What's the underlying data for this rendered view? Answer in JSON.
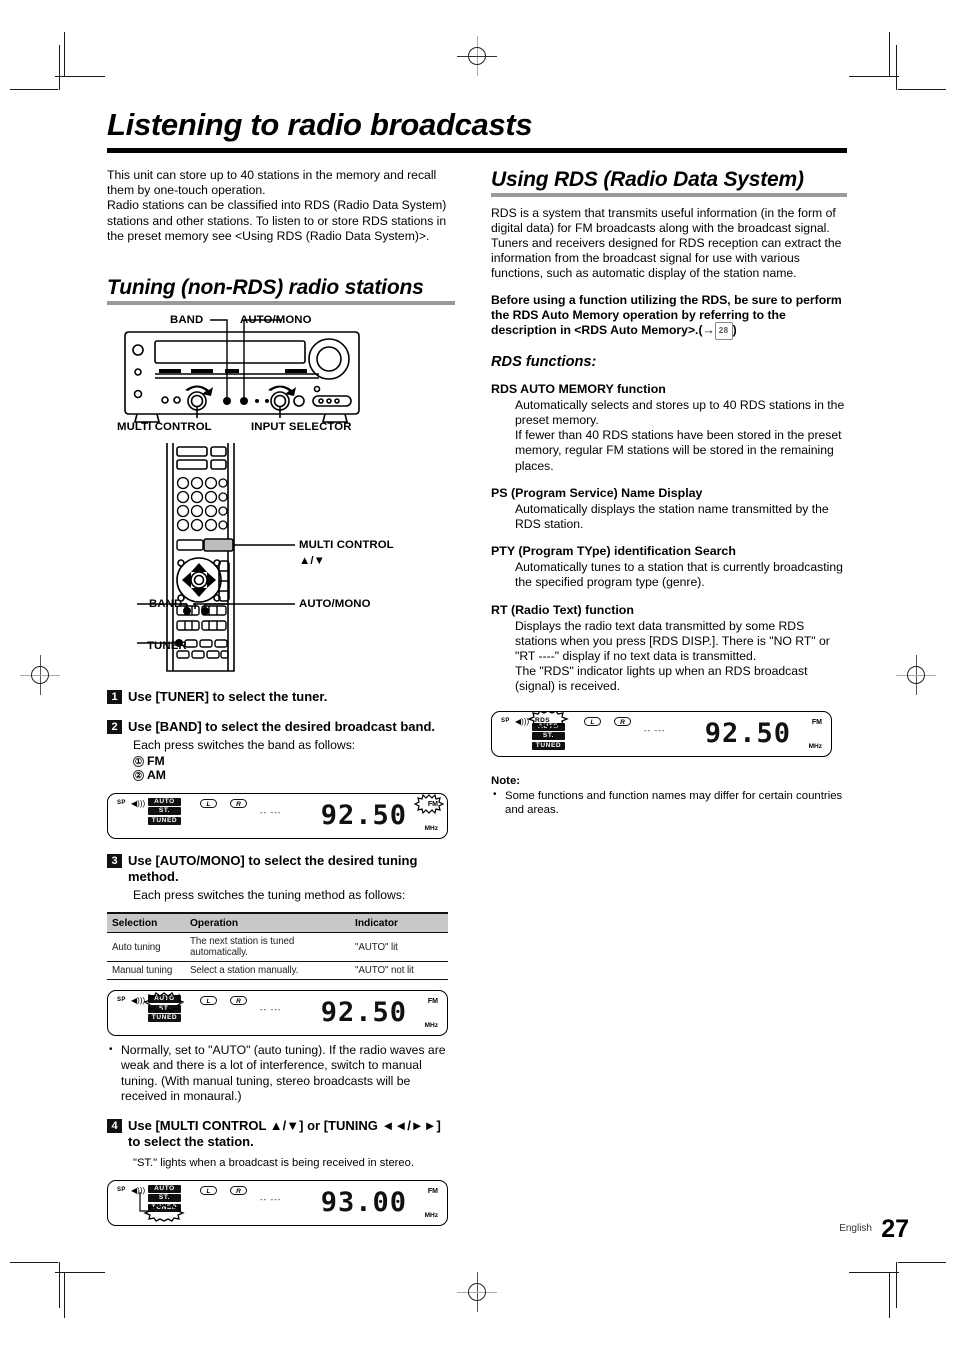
{
  "chapter": {
    "title": "Listening to radio broadcasts"
  },
  "left": {
    "intro": [
      "This unit can store up to 40 stations in the memory and recall them by one-touch operation.",
      "Radio stations can be classified into RDS (Radio Data System) stations and other stations. To listen to or store RDS stations in the preset memory see <Using RDS (Radio Data System)>."
    ],
    "section_title": "Tuning (non-RDS) radio stations",
    "unit_labels": {
      "band": "BAND",
      "auto_mono": "AUTO/MONO",
      "multi_control": "MULTI CONTROL",
      "input_selector": "INPUT SELECTOR"
    },
    "remote_labels": {
      "multi_control": "MULTI CONTROL",
      "multi_control_arrows": "▲/▼",
      "band": "BAND",
      "auto_mono": "AUTO/MONO",
      "tuner": "TUNER"
    },
    "steps": [
      {
        "num": "1",
        "title": "Use [TUNER] to select the tuner."
      },
      {
        "num": "2",
        "title": "Use [BAND] to select the desired broadcast band.",
        "sub": "Each press switches the band as follows:",
        "options": [
          {
            "marker": "①",
            "label": "FM"
          },
          {
            "marker": "②",
            "label": "AM"
          }
        ]
      },
      {
        "num": "3",
        "title": "Use [AUTO/MONO] to select the desired tuning method.",
        "sub": "Each press switches the tuning method as follows:"
      },
      {
        "num": "4",
        "title": "Use [MULTI CONTROL ▲/▼] or [TUNING ◄◄/►►] to select the station.",
        "caption": "\"ST.\" lights when a broadcast is being received in stereo."
      }
    ],
    "table": {
      "headers": [
        "Selection",
        "Operation",
        "Indicator"
      ],
      "rows": [
        [
          "Auto tuning",
          "The next station is tuned automatically.",
          "\"AUTO\" lit"
        ],
        [
          "Manual tuning",
          "Select a station manually.",
          "\"AUTO\" not lit"
        ]
      ]
    },
    "auto_note": "Normally, set to \"AUTO\" (auto tuning). If the radio waves are weak and there is a lot of interference, switch to manual tuning. (With manual tuning, stereo broadcasts will be received in monaural.)",
    "displays": [
      {
        "id": "display-band-fm",
        "sp": "SP",
        "speaker_icon": "speaker-icon",
        "indicators": [
          "AUTO",
          "ST.",
          "TUNED"
        ],
        "channels": [
          "L",
          "R"
        ],
        "dashes": "--  ---",
        "frequency": "92.50",
        "band": "FM",
        "unit": "MHz",
        "highlight": "FM"
      },
      {
        "id": "display-tuning-auto",
        "sp": "SP",
        "speaker_icon": "speaker-icon",
        "indicators": [
          "AUTO",
          "ST.",
          "TUNED"
        ],
        "channels": [
          "L",
          "R"
        ],
        "dashes": "--  ---",
        "frequency": "92.50",
        "band": "FM",
        "unit": "MHz",
        "highlight": "AUTO"
      },
      {
        "id": "display-station-tuned",
        "sp": "SP",
        "speaker_icon": "speaker-icon",
        "indicators": [
          "AUTO",
          "ST.",
          "TUNED"
        ],
        "channels": [
          "L",
          "R"
        ],
        "dashes": "--  ---",
        "frequency": "93.00",
        "band": "FM",
        "unit": "MHz",
        "highlight": "TUNED"
      }
    ]
  },
  "right": {
    "section_title": "Using RDS (Radio Data System)",
    "intro": "RDS is a system that transmits useful information (in the form of digital data) for FM broadcasts along with the broadcast signal. Tuners and receivers designed for RDS reception can extract the information from the broadcast signal for use with various functions, such as automatic display of the station name.",
    "bold_note_pre": "Before using a function utilizing the RDS, be sure to perform the RDS Auto Memory operation by referring to the description in <RDS Auto Memory>.(→",
    "bold_note_page": "28",
    "bold_note_post": ")",
    "functions_heading": "RDS functions:",
    "functions": [
      {
        "name": "RDS AUTO MEMORY function",
        "body": "Automatically selects and stores up to 40 RDS stations in the preset memory.\nIf fewer than 40 RDS stations have been stored in the preset memory, regular FM stations will be stored in the remaining places."
      },
      {
        "name": "PS (Program Service) Name Display",
        "body": "Automatically displays the station name transmitted by the RDS station."
      },
      {
        "name": "PTY (Program TYpe) identification Search",
        "body": "Automatically tunes to a station that is currently broadcasting the specified program type (genre)."
      },
      {
        "name": "RT (Radio Text) function",
        "body": "Displays the radio text data transmitted by some RDS stations when you press [RDS DISP.]. There is \"NO RT\" or \"RT ----\" display if no text data is transmitted.\nThe \"RDS\" indicator lights up when an RDS broadcast (signal) is received."
      }
    ],
    "display": {
      "id": "display-rds",
      "sp": "SP",
      "speaker_icon": "speaker-icon",
      "rds_tag": "RDS",
      "indicators": [
        "AUTO",
        "ST.",
        "TUNED"
      ],
      "channels": [
        "L",
        "R"
      ],
      "dashes": "--  ---",
      "frequency": "92.50",
      "band": "FM",
      "unit": "MHz",
      "highlight": "RDS"
    },
    "note_label": "Note:",
    "note_items": [
      "Some functions and function names may differ for certain countries and areas."
    ]
  },
  "footer": {
    "language": "English",
    "page_number": "27"
  },
  "colors": {
    "rule_black": "#000000",
    "rule_gray": "#9a9a9a",
    "table_header_bg": "#c8c8c8",
    "step_badge_bg": "#111111"
  }
}
